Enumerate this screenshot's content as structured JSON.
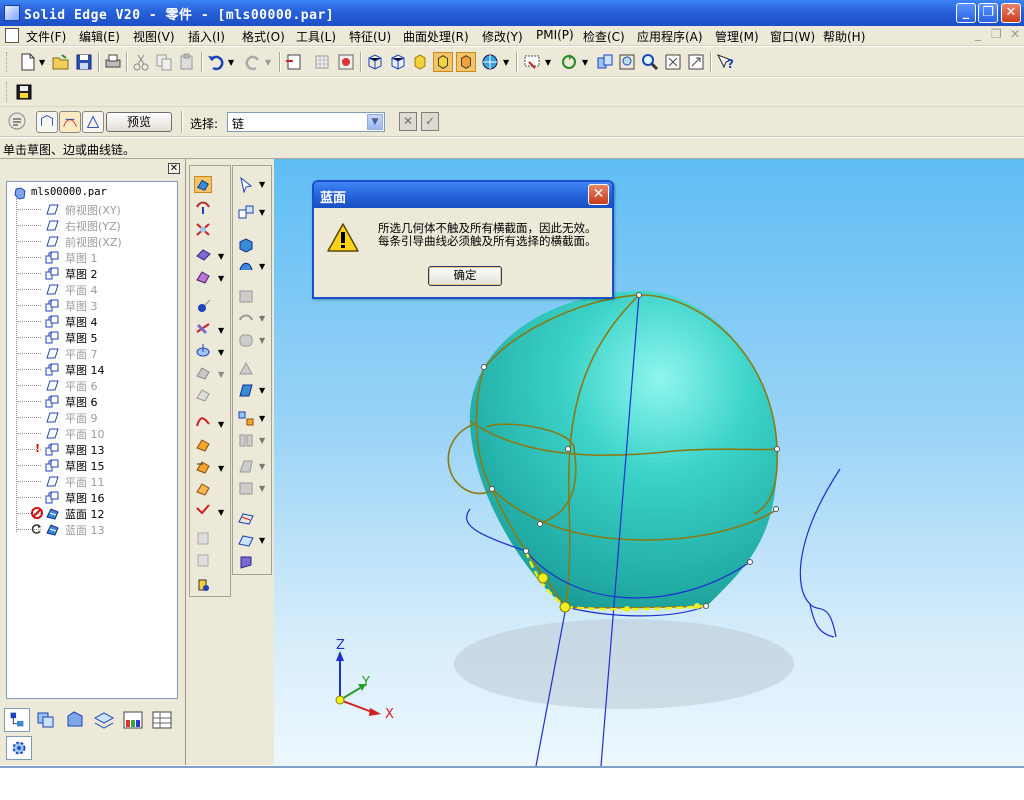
{
  "window": {
    "title": "Solid Edge V20 - 零件 - [mls00000.par]",
    "minimize": "_",
    "restore": "❐",
    "close": "✕"
  },
  "menu": {
    "items": [
      "文件(F)",
      "编辑(E)",
      "视图(V)",
      "插入(I)",
      "格式(O)",
      "工具(L)",
      "特征(U)",
      "曲面处理(R)",
      "修改(Y)",
      "PMI(P)",
      "检查(C)",
      "应用程序(A)",
      "管理(M)",
      "窗口(W)",
      "帮助(H)"
    ],
    "mdi_minimize": "_",
    "mdi_restore": "❐",
    "mdi_close": "✕"
  },
  "ribbon": {
    "preview_label": "预览",
    "select_label": "选择:",
    "select_value": "链",
    "cancel_glyph": "✕",
    "accept_glyph": "✓"
  },
  "prompt": "单击草图、边或曲线链。",
  "panel": {
    "close": "✕",
    "root": "mls00000.par",
    "items": [
      {
        "label": "俯视图(XY)",
        "type": "plane",
        "dim": true
      },
      {
        "label": "右视图(YZ)",
        "type": "plane",
        "dim": true
      },
      {
        "label": "前视图(XZ)",
        "type": "plane",
        "dim": true
      },
      {
        "label": "草图 1",
        "type": "sketch",
        "dim": true
      },
      {
        "label": "草图 2",
        "type": "sketch",
        "dim": false
      },
      {
        "label": "平面 4",
        "type": "plane",
        "dim": true
      },
      {
        "label": "草图 3",
        "type": "sketch",
        "dim": true
      },
      {
        "label": "草图 4",
        "type": "sketch",
        "dim": false
      },
      {
        "label": "草图 5",
        "type": "sketch",
        "dim": false
      },
      {
        "label": "平面 7",
        "type": "plane",
        "dim": true
      },
      {
        "label": "草图 14",
        "type": "sketch",
        "dim": false
      },
      {
        "label": "平面 6",
        "type": "plane",
        "dim": true
      },
      {
        "label": "草图 6",
        "type": "sketch",
        "dim": false
      },
      {
        "label": "平面 9",
        "type": "plane",
        "dim": true
      },
      {
        "label": "平面 10",
        "type": "plane",
        "dim": true
      },
      {
        "label": "草图 13",
        "type": "sketch",
        "dim": false,
        "warning": "!"
      },
      {
        "label": "草图 15",
        "type": "sketch",
        "dim": false
      },
      {
        "label": "平面 11",
        "type": "plane",
        "dim": true
      },
      {
        "label": "草图 16",
        "type": "sketch",
        "dim": false
      },
      {
        "label": "蓝面 12",
        "type": "bluesurf",
        "dim": false,
        "error": true
      },
      {
        "label": "蓝面 13",
        "type": "bluesurf",
        "dim": true,
        "rollback": true
      }
    ]
  },
  "dialog": {
    "title": "蓝面",
    "close": "✕",
    "line1": "所选几何体不触及所有横截面，因此无效。",
    "line2": "每条引导曲线必须触及所有选择的横截面。",
    "ok": "确定"
  },
  "triad": {
    "z": "Z",
    "y": "Y",
    "x": "X"
  },
  "colors": {
    "surface": "#33c8c0",
    "curves_olive": "#8a7a12",
    "curves_blue": "#1f2fd0",
    "highlight": "#f0f020",
    "titlebar": "#2760d8"
  }
}
